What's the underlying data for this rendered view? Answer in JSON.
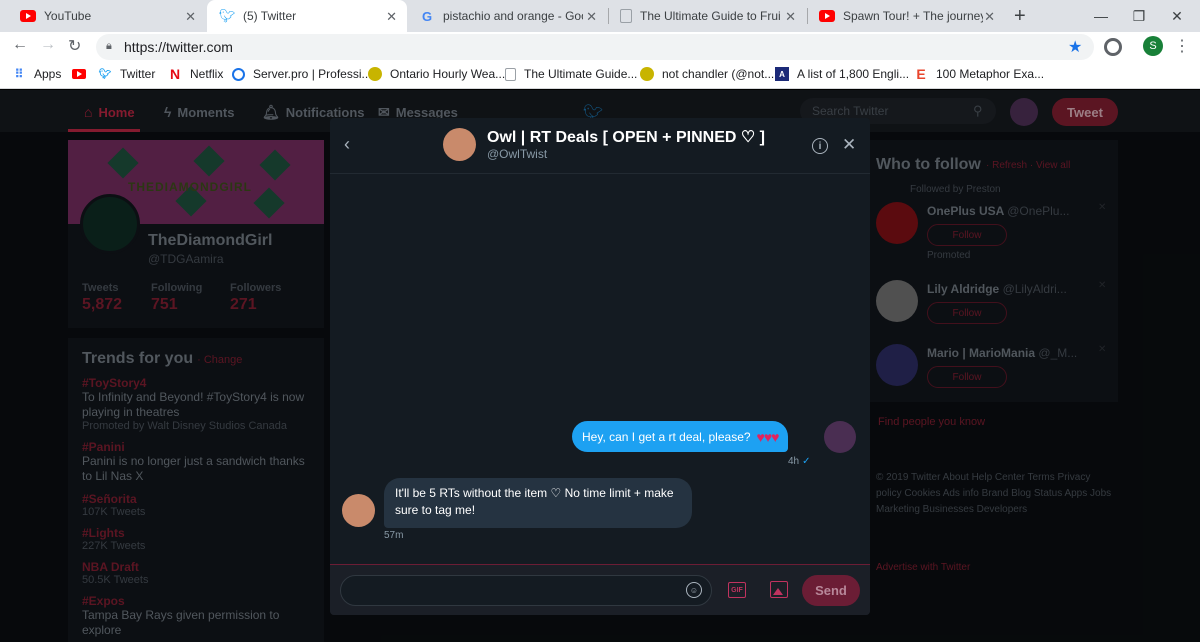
{
  "browser": {
    "tabs": [
      {
        "label": "YouTube",
        "icon": "youtube-icon"
      },
      {
        "label": "(5) Twitter",
        "icon": "twitter-icon"
      },
      {
        "label": "pistachio and orange - Google",
        "icon": "google-icon"
      },
      {
        "label": "The Ultimate Guide to Fruit Fla",
        "icon": "page-icon"
      },
      {
        "label": "Spawn Tour! + The journey to",
        "icon": "youtube-icon"
      }
    ],
    "url": "https://twitter.com",
    "profile_initial": "S",
    "bookmarks": [
      {
        "label": "Apps"
      },
      {
        "label": ""
      },
      {
        "label": "Twitter"
      },
      {
        "label": "Netflix"
      },
      {
        "label": "Server.pro | Professi..."
      },
      {
        "label": "Ontario Hourly Wea..."
      },
      {
        "label": "The Ultimate Guide..."
      },
      {
        "label": "not chandler (@not..."
      },
      {
        "label": "A list of 1,800 Engli..."
      },
      {
        "label": "100 Metaphor Exa..."
      }
    ]
  },
  "twitter": {
    "nav": {
      "home": "Home",
      "moments": "Moments",
      "notifications": "Notifications",
      "messages": "Messages",
      "search_placeholder": "Search Twitter",
      "tweet_button": "Tweet"
    },
    "profile": {
      "banner_text": "THEDIAMONDGIRL",
      "name": "TheDiamondGirl",
      "handle": "@TDGAamira",
      "stats": [
        {
          "label": "Tweets",
          "value": "5,872"
        },
        {
          "label": "Following",
          "value": "751"
        },
        {
          "label": "Followers",
          "value": "271"
        }
      ]
    },
    "trends": {
      "title": "Trends for you",
      "change": "· Change",
      "items": [
        {
          "name": "#ToyStory4",
          "desc": "To Infinity and Beyond! #ToyStory4 is now playing in theatres",
          "count": "Promoted by Walt Disney Studios Canada"
        },
        {
          "name": "#Panini",
          "desc": "Panini is no longer just a sandwich thanks to Lil Nas X",
          "count": ""
        },
        {
          "name": "#Señorita",
          "desc": "",
          "count": "107K Tweets"
        },
        {
          "name": "#Lights",
          "desc": "",
          "count": "227K Tweets"
        },
        {
          "name": "NBA Draft",
          "desc": "",
          "count": "50.5K Tweets"
        },
        {
          "name": "#Expos",
          "desc": "Tampa Bay Rays given permission to explore",
          "count": ""
        }
      ]
    },
    "who_to_follow": {
      "title": "Who to follow",
      "links": "· Refresh · View all",
      "followed_by": "Followed by Preston",
      "suggestions": [
        {
          "name": "OnePlus USA",
          "handle": "@OnePlu...",
          "follow": "Follow",
          "note": "Promoted"
        },
        {
          "name": "Lily Aldridge",
          "handle": "@LilyAldri...",
          "follow": "Follow",
          "note": ""
        },
        {
          "name": "Mario | MarioMania",
          "handle": "@_M...",
          "follow": "Follow",
          "note": ""
        }
      ],
      "find_people": "Find people you know"
    },
    "footer": "© 2019 Twitter  About  Help Center  Terms  Privacy policy  Cookies  Ads info  Brand  Blog  Status  Apps  Jobs  Marketing  Businesses  Developers",
    "advertise": "Advertise with Twitter"
  },
  "dm": {
    "name": "Owl | RT Deals [ OPEN + PINNED ♡ ]",
    "handle": "@OwlTwist",
    "messages": [
      {
        "direction": "out",
        "text": "Hey, can I get a rt deal, please?",
        "emoji": "♥♥♥",
        "time": "4h"
      },
      {
        "direction": "in",
        "text": "It'll be 5 RTs without the item ♡ No time limit + make sure to tag me!",
        "time": "57m"
      }
    ],
    "send_label": "Send",
    "gif_label": "GIF",
    "colors": {
      "accent": "#1da1f2",
      "incoming": "#253341",
      "send": "#6b1d35"
    }
  }
}
